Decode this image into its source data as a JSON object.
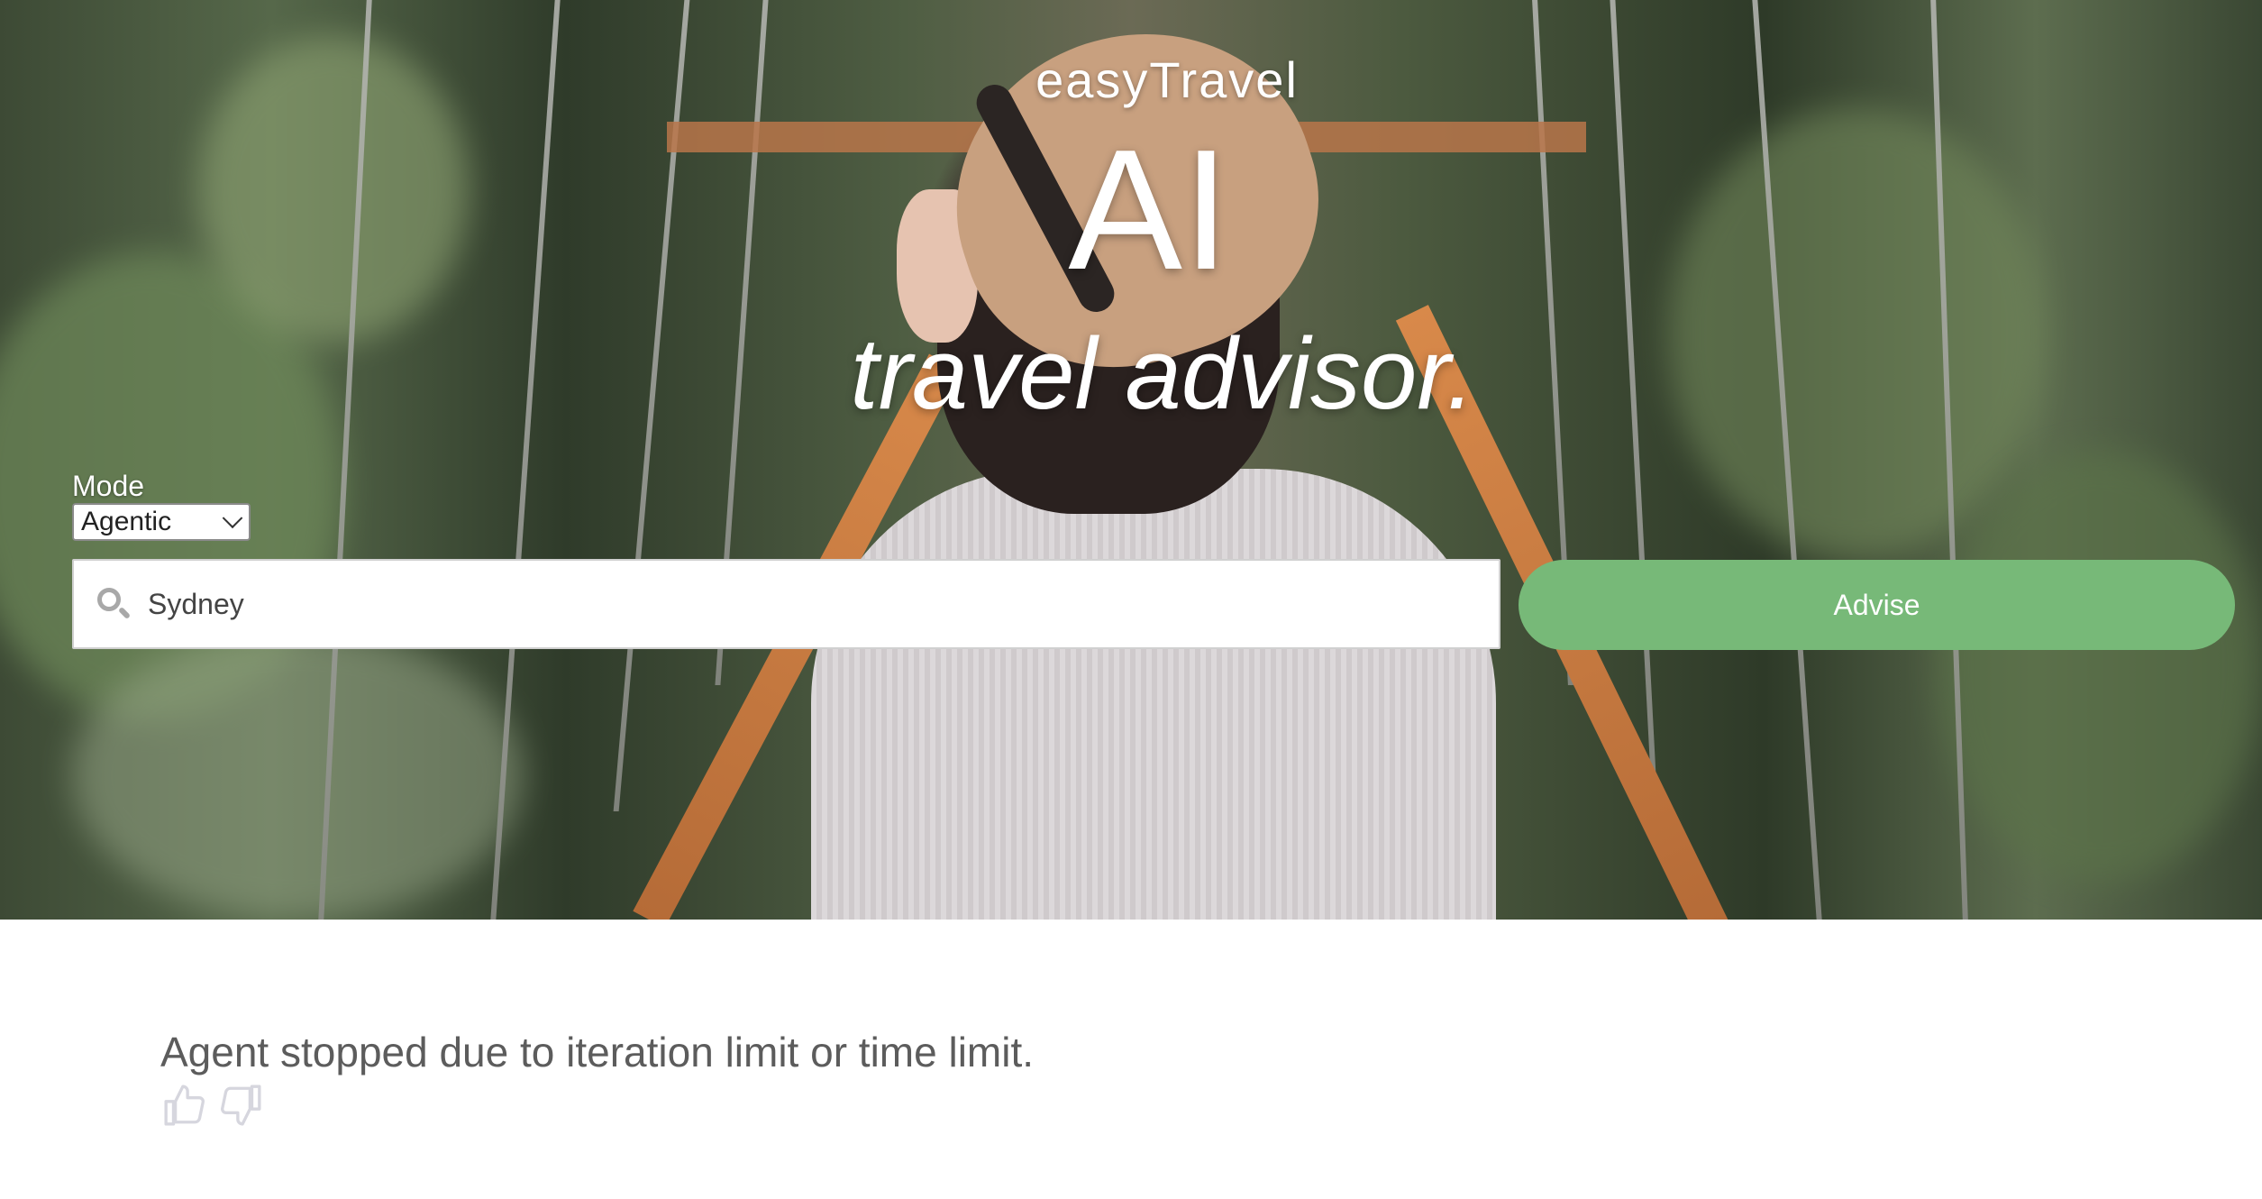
{
  "hero": {
    "brand": "easyTravel",
    "headline": "AI",
    "tagline": "travel advisor."
  },
  "mode": {
    "label": "Mode",
    "selected": "Agentic"
  },
  "search": {
    "value": "Sydney",
    "icon": "search-icon"
  },
  "advise_button": {
    "label": "Advise",
    "color": "#77b978"
  },
  "result": {
    "message": "Agent stopped due to iteration limit or time limit."
  },
  "feedback": {
    "like_icon": "thumbs-up-icon",
    "dislike_icon": "thumbs-down-icon",
    "icon_color": "#d6d6de"
  }
}
